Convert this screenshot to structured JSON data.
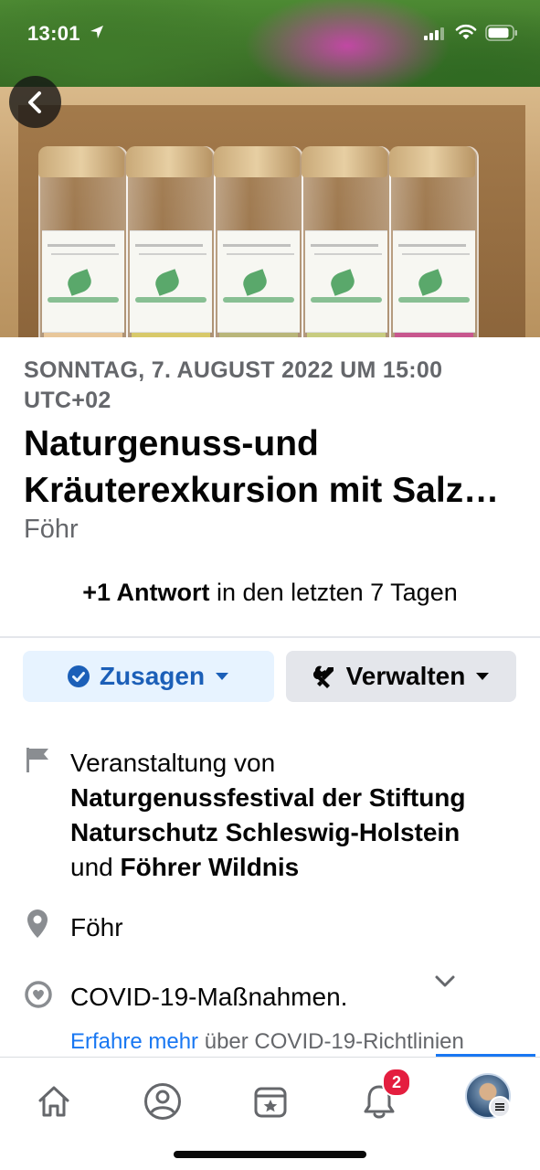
{
  "status_bar": {
    "time": "13:01"
  },
  "event": {
    "date_line": "SONNTAG, 7. AUGUST 2022 UM 15:00 UTC+02",
    "title_line1": "Naturgenuss-und",
    "title_line2": "Kräuterexkursion mit Salz…",
    "place": "Föhr",
    "answers_count": "+1 Antwort",
    "answers_suffix": " in den letzten 7 Tagen"
  },
  "actions": {
    "going_label": "Zusagen",
    "manage_label": "Verwalten"
  },
  "details": {
    "organizer_prefix": "Veranstaltung von",
    "organizer_1": "Naturgenussfestival der Stiftung Naturschutz Schleswig-Holstein",
    "organizer_joiner": "und",
    "organizer_2": "Föhrer Wildnis",
    "location": "Föhr",
    "covid_title": "COVID-19-Maßnahmen.",
    "learn_more_link": "Erfahre mehr",
    "learn_more_suffix": " über COVID-19-Richtlinien"
  },
  "tabbar": {
    "notifications_badge": "2",
    "icons": [
      "home-icon",
      "profile-icon",
      "events-icon",
      "bell-icon",
      "avatar"
    ]
  },
  "colors": {
    "accent": "#1877f2",
    "going_bg": "#e7f3ff",
    "secondary_text": "#65676b",
    "badge": "#e41e3f"
  }
}
